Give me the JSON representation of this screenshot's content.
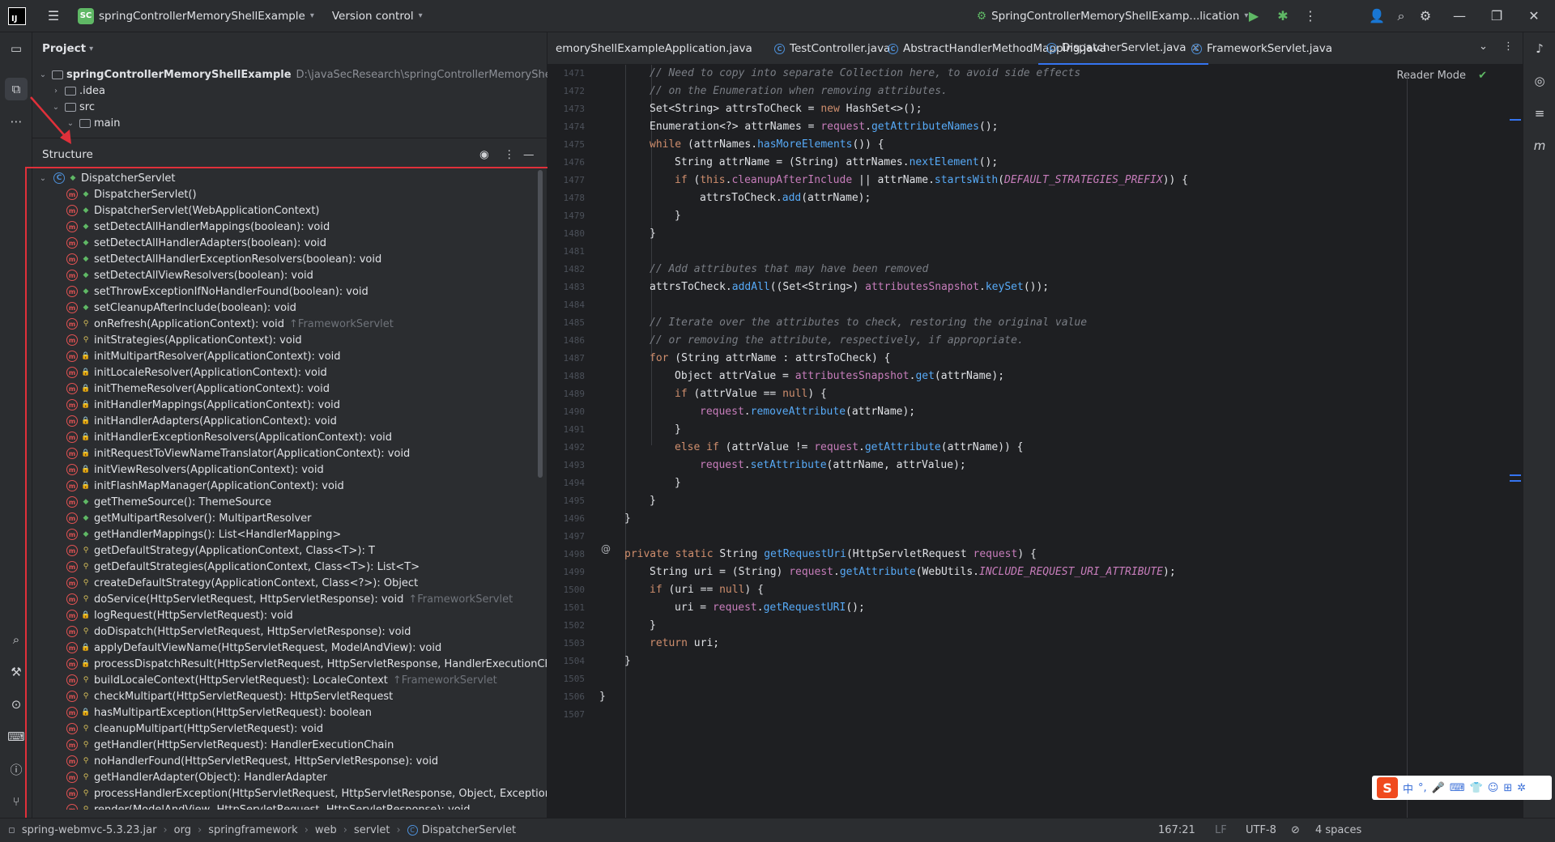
{
  "titlebar": {
    "project_badge": "SC",
    "project_name": "springControllerMemoryShellExample",
    "version_control": "Version control",
    "run_config": "SpringControllerMemoryShellExamp...lication"
  },
  "project_panel": {
    "title": "Project",
    "root_name": "springControllerMemoryShellExample",
    "root_path": "D:\\javaSecResearch\\springControllerMemoryShellExamp",
    "items": [
      ".idea",
      "src",
      "main"
    ]
  },
  "structure_panel": {
    "title": "Structure",
    "class_name": "DispatcherServlet",
    "members": [
      {
        "sig": "DispatcherServlet()",
        "vis": "pub",
        "inherit": ""
      },
      {
        "sig": "DispatcherServlet(WebApplicationContext)",
        "vis": "pub",
        "inherit": ""
      },
      {
        "sig": "setDetectAllHandlerMappings(boolean): void",
        "vis": "pub",
        "inherit": ""
      },
      {
        "sig": "setDetectAllHandlerAdapters(boolean): void",
        "vis": "pub",
        "inherit": ""
      },
      {
        "sig": "setDetectAllHandlerExceptionResolvers(boolean): void",
        "vis": "pub",
        "inherit": ""
      },
      {
        "sig": "setDetectAllViewResolvers(boolean): void",
        "vis": "pub",
        "inherit": ""
      },
      {
        "sig": "setThrowExceptionIfNoHandlerFound(boolean): void",
        "vis": "pub",
        "inherit": ""
      },
      {
        "sig": "setCleanupAfterInclude(boolean): void",
        "vis": "pub",
        "inherit": ""
      },
      {
        "sig": "onRefresh(ApplicationContext): void",
        "vis": "prot",
        "inherit": "↑FrameworkServlet"
      },
      {
        "sig": "initStrategies(ApplicationContext): void",
        "vis": "prot",
        "inherit": ""
      },
      {
        "sig": "initMultipartResolver(ApplicationContext): void",
        "vis": "priv",
        "inherit": ""
      },
      {
        "sig": "initLocaleResolver(ApplicationContext): void",
        "vis": "priv",
        "inherit": ""
      },
      {
        "sig": "initThemeResolver(ApplicationContext): void",
        "vis": "priv",
        "inherit": ""
      },
      {
        "sig": "initHandlerMappings(ApplicationContext): void",
        "vis": "priv",
        "inherit": ""
      },
      {
        "sig": "initHandlerAdapters(ApplicationContext): void",
        "vis": "priv",
        "inherit": ""
      },
      {
        "sig": "initHandlerExceptionResolvers(ApplicationContext): void",
        "vis": "priv",
        "inherit": ""
      },
      {
        "sig": "initRequestToViewNameTranslator(ApplicationContext): void",
        "vis": "priv",
        "inherit": ""
      },
      {
        "sig": "initViewResolvers(ApplicationContext): void",
        "vis": "priv",
        "inherit": ""
      },
      {
        "sig": "initFlashMapManager(ApplicationContext): void",
        "vis": "priv",
        "inherit": ""
      },
      {
        "sig": "getThemeSource(): ThemeSource",
        "vis": "pub",
        "inherit": ""
      },
      {
        "sig": "getMultipartResolver(): MultipartResolver",
        "vis": "pub",
        "inherit": ""
      },
      {
        "sig": "getHandlerMappings(): List<HandlerMapping>",
        "vis": "pub",
        "inherit": ""
      },
      {
        "sig": "getDefaultStrategy(ApplicationContext, Class<T>): T",
        "vis": "prot",
        "inherit": ""
      },
      {
        "sig": "getDefaultStrategies(ApplicationContext, Class<T>): List<T>",
        "vis": "prot",
        "inherit": ""
      },
      {
        "sig": "createDefaultStrategy(ApplicationContext, Class<?>): Object",
        "vis": "prot",
        "inherit": ""
      },
      {
        "sig": "doService(HttpServletRequest, HttpServletResponse): void",
        "vis": "prot",
        "inherit": "↑FrameworkServlet"
      },
      {
        "sig": "logRequest(HttpServletRequest): void",
        "vis": "priv",
        "inherit": ""
      },
      {
        "sig": "doDispatch(HttpServletRequest, HttpServletResponse): void",
        "vis": "prot",
        "inherit": ""
      },
      {
        "sig": "applyDefaultViewName(HttpServletRequest, ModelAndView): void",
        "vis": "priv",
        "inherit": ""
      },
      {
        "sig": "processDispatchResult(HttpServletRequest, HttpServletResponse, HandlerExecutionCha",
        "vis": "priv",
        "inherit": ""
      },
      {
        "sig": "buildLocaleContext(HttpServletRequest): LocaleContext",
        "vis": "prot",
        "inherit": "↑FrameworkServlet"
      },
      {
        "sig": "checkMultipart(HttpServletRequest): HttpServletRequest",
        "vis": "prot",
        "inherit": ""
      },
      {
        "sig": "hasMultipartException(HttpServletRequest): boolean",
        "vis": "priv",
        "inherit": ""
      },
      {
        "sig": "cleanupMultipart(HttpServletRequest): void",
        "vis": "prot",
        "inherit": ""
      },
      {
        "sig": "getHandler(HttpServletRequest): HandlerExecutionChain",
        "vis": "prot",
        "inherit": ""
      },
      {
        "sig": "noHandlerFound(HttpServletRequest, HttpServletResponse): void",
        "vis": "prot",
        "inherit": ""
      },
      {
        "sig": "getHandlerAdapter(Object): HandlerAdapter",
        "vis": "prot",
        "inherit": ""
      },
      {
        "sig": "processHandlerException(HttpServletRequest, HttpServletResponse, Object, Exception)",
        "vis": "prot",
        "inherit": ""
      },
      {
        "sig": "render(ModelAndView, HttpServletRequest, HttpServletResponse): void",
        "vis": "prot",
        "inherit": ""
      }
    ]
  },
  "editor": {
    "tabs": [
      {
        "label": "emoryShellExampleApplication.java",
        "active": false
      },
      {
        "label": "TestController.java",
        "active": false
      },
      {
        "label": "AbstractHandlerMethodMapping.java",
        "active": false
      },
      {
        "label": "DispatcherServlet.java",
        "active": true
      },
      {
        "label": "FrameworkServlet.java",
        "active": false
      }
    ],
    "reader_mode": "Reader Mode",
    "line_numbers": [
      "1471",
      "1472",
      "1473",
      "1474",
      "1475",
      "1476",
      "1477",
      "1478",
      "1479",
      "1480",
      "1481",
      "1482",
      "1483",
      "1484",
      "1485",
      "1486",
      "1487",
      "1488",
      "1489",
      "1490",
      "1491",
      "1492",
      "1493",
      "1494",
      "1495",
      "1496",
      "1497",
      "1498",
      "1499",
      "1500",
      "1501",
      "1502",
      "1503",
      "1504",
      "1505",
      "1506",
      "1507"
    ],
    "code_lines": [
      "// Need to copy into separate Collection here, to avoid side effects",
      "// on the Enumeration when removing attributes.",
      "Set<String> attrsToCheck = new HashSet<>();",
      "Enumeration<?> attrNames = request.getAttributeNames();",
      "while (attrNames.hasMoreElements()) {",
      "String attrName = (String) attrNames.nextElement();",
      "if (this.cleanupAfterInclude || attrName.startsWith(DEFAULT_STRATEGIES_PREFIX)) {",
      "attrsToCheck.add(attrName);",
      "}",
      "}",
      "",
      "// Add attributes that may have been removed",
      "attrsToCheck.addAll((Set<String>) attributesSnapshot.keySet());",
      "",
      "// Iterate over the attributes to check, restoring the original value",
      "// or removing the attribute, respectively, if appropriate.",
      "for (String attrName : attrsToCheck) {",
      "Object attrValue = attributesSnapshot.get(attrName);",
      "if (attrValue == null) {",
      "request.removeAttribute(attrName);",
      "}",
      "else if (attrValue != request.getAttribute(attrName)) {",
      "request.setAttribute(attrName, attrValue);",
      "}",
      "}",
      "}",
      "",
      "private static String getRequestUri(HttpServletRequest request) {",
      "String uri = (String) request.getAttribute(WebUtils.INCLUDE_REQUEST_URI_ATTRIBUTE);",
      "if (uri == null) {",
      "uri = request.getRequestURI();",
      "}",
      "return uri;",
      "}",
      "",
      "}",
      ""
    ]
  },
  "statusbar": {
    "crumbs": [
      "spring-webmvc-5.3.23.jar",
      "org",
      "springframework",
      "web",
      "servlet",
      "DispatcherServlet"
    ],
    "position": "167:21",
    "line_sep": "LF",
    "encoding": "UTF-8",
    "indent": "4 spaces"
  },
  "ime": {
    "logo": "S",
    "lang": "中"
  }
}
